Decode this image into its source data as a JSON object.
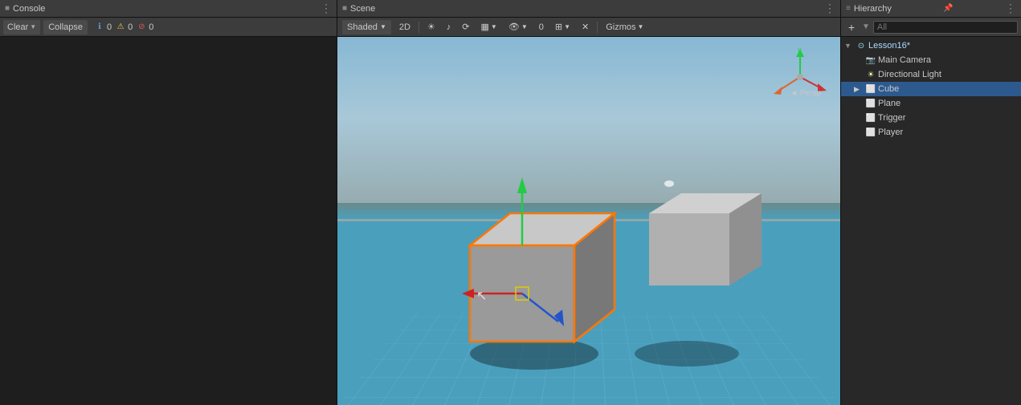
{
  "console": {
    "tab_icon": "■",
    "tab_title": "Console",
    "more_btn": "⋮",
    "clear_label": "Clear",
    "collapse_label": "Collapse",
    "info_count": "0",
    "warn_count": "0",
    "error_count": "0"
  },
  "scene": {
    "tab_icon": "■",
    "tab_title": "Scene",
    "more_btn": "⋮",
    "shaded_label": "Shaded",
    "twod_label": "2D",
    "gizmos_label": "Gizmos",
    "persp_label": "◄ Persp",
    "toolbar_icons": [
      "☀",
      "🔊",
      "⟳",
      "▦",
      "👁",
      "0",
      "⊞",
      "✕",
      "□",
      "⋮"
    ]
  },
  "hierarchy": {
    "tab_icon": "≡",
    "tab_title": "Hierarchy",
    "more_btn": "⋮",
    "pin_icon": "📌",
    "add_label": "+",
    "search_placeholder": "All",
    "items": [
      {
        "id": "lesson16",
        "label": "Lesson16*",
        "indent": 0,
        "has_arrow": true,
        "arrow_dir": "down",
        "icon": "scene",
        "selected": false
      },
      {
        "id": "main-camera",
        "label": "Main Camera",
        "indent": 1,
        "has_arrow": false,
        "icon": "camera",
        "selected": false
      },
      {
        "id": "directional-light",
        "label": "Directional Light",
        "indent": 1,
        "has_arrow": false,
        "icon": "light",
        "selected": false
      },
      {
        "id": "cube",
        "label": "Cube",
        "indent": 1,
        "has_arrow": true,
        "arrow_dir": "right",
        "icon": "cube",
        "selected": true
      },
      {
        "id": "plane",
        "label": "Plane",
        "indent": 1,
        "has_arrow": false,
        "icon": "cube",
        "selected": false
      },
      {
        "id": "trigger",
        "label": "Trigger",
        "indent": 1,
        "has_arrow": false,
        "icon": "cube",
        "selected": false
      },
      {
        "id": "player",
        "label": "Player",
        "indent": 1,
        "has_arrow": false,
        "icon": "cube",
        "selected": false
      }
    ]
  }
}
